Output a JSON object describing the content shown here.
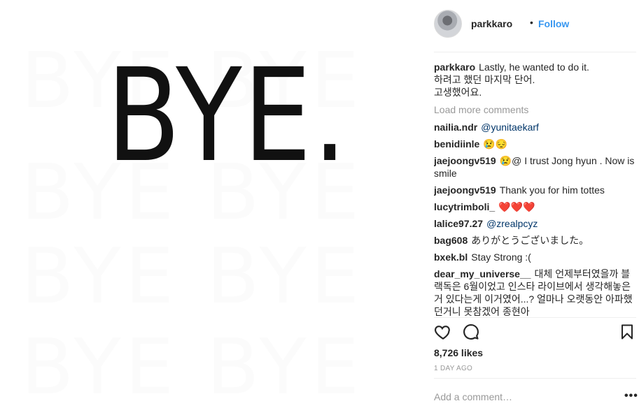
{
  "post": {
    "image_text": "BYE.",
    "username": "parkkaro",
    "separator": "•",
    "follow_label": "Follow",
    "caption_lines": [
      "Lastly, he wanted to do it.",
      "하려고 했던 마지막 단어.",
      "고생했어요."
    ],
    "load_more_label": "Load more comments",
    "comments": [
      {
        "user": "nailia.ndr",
        "text": "@yunitaekarf",
        "mention": true
      },
      {
        "user": "benidiinle",
        "text": "😢😔",
        "mention": false
      },
      {
        "user": "jaejoongv519",
        "text": "😢@ I trust Jong hyun . Now is smile",
        "mention": false
      },
      {
        "user": "jaejoongv519",
        "text": "Thank you for him tottes",
        "mention": false
      },
      {
        "user": "lucytrimboli_",
        "text": "❤️❤️❤️",
        "mention": false
      },
      {
        "user": "lalice97.27",
        "text": "@zrealpcyz",
        "mention": true
      },
      {
        "user": "bag608",
        "text": "ありがとうございました。",
        "mention": false
      },
      {
        "user": "bxek.bl",
        "text": "Stay Strong :(",
        "mention": false
      },
      {
        "user": "dear_my_universe__",
        "text": "대체 언제부터였을까 블랙독은 6월이었고 인스타 라이브에서 생각해놓은거 있다는게 이거였어...? 얼마나 오랫동안 아파했던거니 못참겠어 종현아",
        "mention": false
      }
    ],
    "likes": "8,726 likes",
    "time": "1 DAY AGO",
    "add_comment_placeholder": "Add a comment…",
    "more_label": "•••"
  },
  "icons": {
    "like": "heart-icon",
    "comment": "comment-icon",
    "save": "bookmark-icon",
    "more": "more-options-icon"
  },
  "colors": {
    "link": "#3897f0",
    "mention": "#003569",
    "muted": "#999999",
    "text": "#262626"
  }
}
